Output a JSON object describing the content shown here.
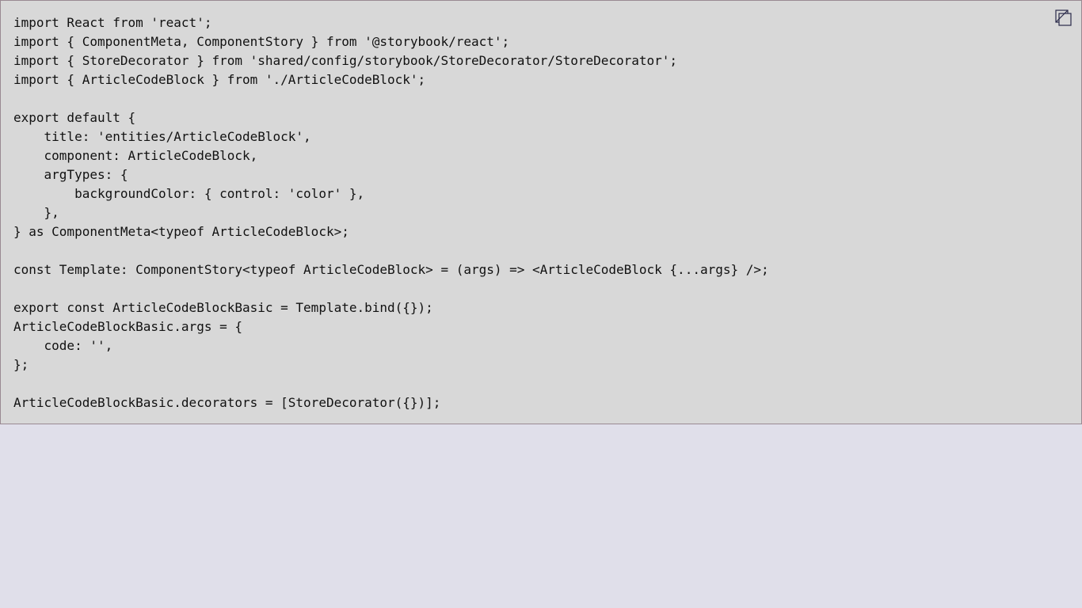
{
  "code_block": {
    "lines": [
      "import React from 'react';",
      "import { ComponentMeta, ComponentStory } from '@storybook/react';",
      "import { StoreDecorator } from 'shared/config/storybook/StoreDecorator/StoreDecorator';",
      "import { ArticleCodeBlock } from './ArticleCodeBlock';",
      "",
      "export default {",
      "    title: 'entities/ArticleCodeBlock',",
      "    component: ArticleCodeBlock,",
      "    argTypes: {",
      "        backgroundColor: { control: 'color' },",
      "    },",
      "} as ComponentMeta<typeof ArticleCodeBlock>;",
      "",
      "const Template: ComponentStory<typeof ArticleCodeBlock> = (args) => <ArticleCodeBlock {...args} />;",
      "",
      "export const ArticleCodeBlockBasic = Template.bind({});",
      "ArticleCodeBlockBasic.args = {",
      "    code: '',",
      "};",
      "",
      "ArticleCodeBlockBasic.decorators = [StoreDecorator({})];"
    ],
    "copy_icon": "copy-icon"
  },
  "colors": {
    "page_background": "#e0dfea",
    "code_background": "#d8d8d8",
    "border": "#9a8a92",
    "text": "#111111",
    "icon_stroke": "#2a2a4a"
  }
}
